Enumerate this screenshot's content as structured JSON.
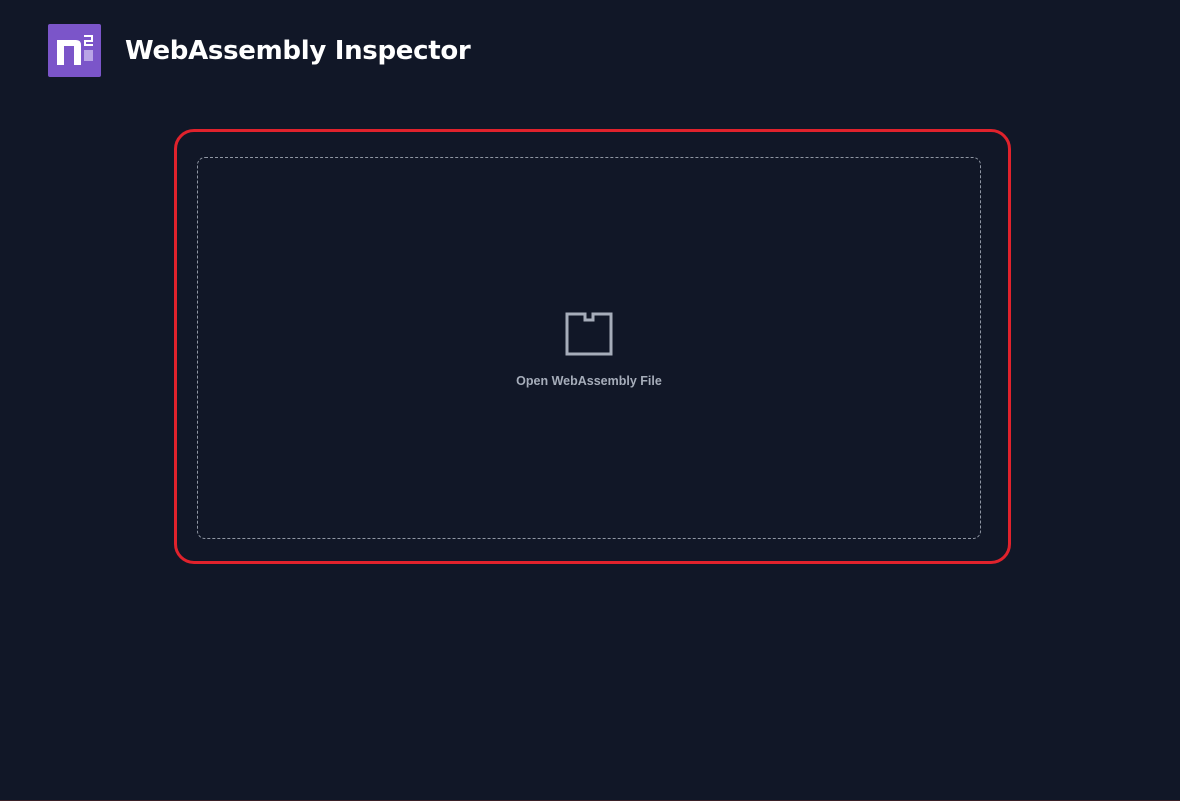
{
  "header": {
    "title": "WebAssembly Inspector",
    "logo_icon": "n2-logo-icon",
    "logo_color": "#7b55c9"
  },
  "drop_zone": {
    "label": "Open WebAssembly File",
    "icon": "file-box-icon"
  },
  "colors": {
    "background": "#111727",
    "highlight": "#e0222c",
    "dashed_border": "#8f96a3",
    "text_muted": "#a6adba"
  }
}
